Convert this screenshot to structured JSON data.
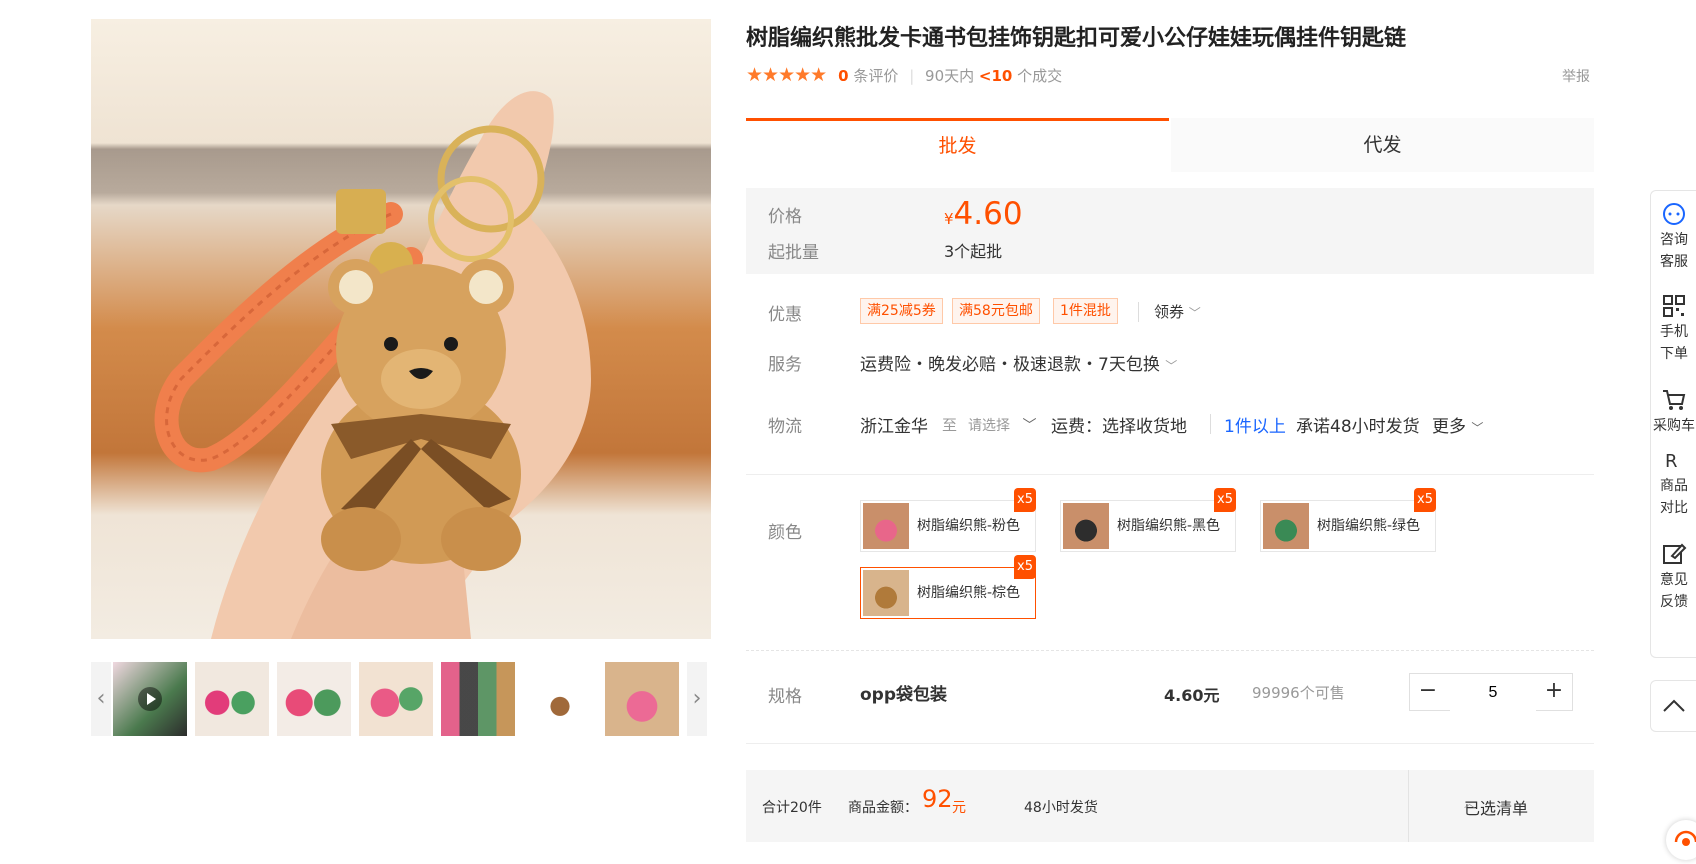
{
  "product": {
    "title": "树脂编织熊批发卡通书包挂饰钥匙扣可爱小公仔娃娃玩偶挂件钥匙链",
    "stars": "★★★★★",
    "review_count": "0",
    "review_label": "条评价",
    "sales_period": "90天内",
    "sales_count": "<10",
    "sales_label": "个成交",
    "report": "举报"
  },
  "tabs": {
    "wholesale": "批发",
    "dropship": "代发"
  },
  "price": {
    "price_label": "价格",
    "currency": "¥",
    "value": "4.60",
    "moq_label": "起批量",
    "moq_value": "3个起批"
  },
  "promo": {
    "label": "优惠",
    "tags": [
      "满25减5券",
      "满58元包邮",
      "1件混批"
    ],
    "coupon": "领券"
  },
  "service": {
    "label": "服务",
    "text": "运费险・晚发必赔・极速退款・7天包换"
  },
  "logistics": {
    "label": "物流",
    "origin": "浙江金华",
    "to": "至",
    "select": "请选择",
    "freight": "运费：选择收货地",
    "qty_rule": "1件以上",
    "promise": "承诺48小时发货",
    "more": "更多"
  },
  "colors": {
    "label": "颜色",
    "options": [
      {
        "name": "树脂编织熊-粉色",
        "badge": "x5",
        "color": "#e8668a"
      },
      {
        "name": "树脂编织熊-黑色",
        "badge": "x5",
        "color": "#2d2d2d"
      },
      {
        "name": "树脂编织熊-绿色",
        "badge": "x5",
        "color": "#3a8a55"
      },
      {
        "name": "树脂编织熊-棕色",
        "badge": "x5",
        "color": "#b07a3a"
      }
    ]
  },
  "spec": {
    "label": "规格",
    "name": "opp袋包装",
    "price": "4.60元",
    "stock": "99996个可售",
    "quantity": "5"
  },
  "footer": {
    "total_qty": "合计20件",
    "amount_label": "商品金额：",
    "amount": "92",
    "unit": "元",
    "ship": "48小时发货",
    "selected_list": "已选清单"
  },
  "sidebar": {
    "consult": "咨询客服",
    "mobile": "手机下单",
    "cart": "采购车",
    "compare": "商品对比",
    "feedback": "意见反馈"
  },
  "colors_theme": {
    "accent": "#ff5000",
    "link": "#1a66ff"
  }
}
